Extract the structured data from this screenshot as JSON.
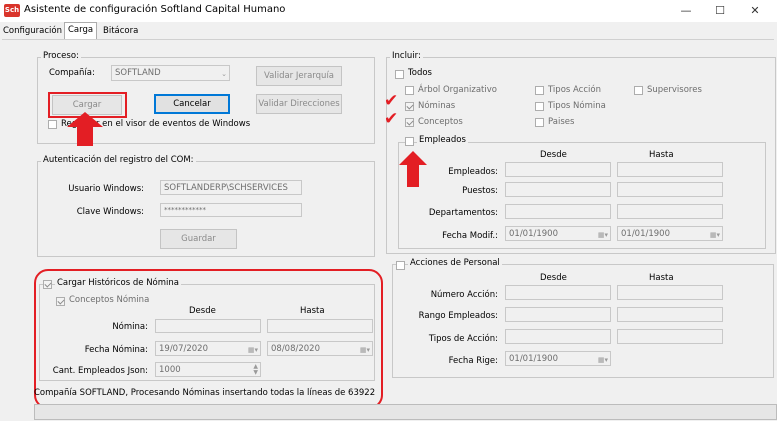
{
  "window": {
    "title": "Asistente de configuración Softland Capital Humano",
    "app_icon_text": "Sch"
  },
  "tabs": [
    {
      "label": "Configuración"
    },
    {
      "label": "Carga"
    },
    {
      "label": "Bitácora"
    }
  ],
  "proceso": {
    "group_label": "Proceso:",
    "company_label": "Compañía:",
    "company_value": "SOFTLAND",
    "validar_jerarquia": "Validar Jerarquía",
    "validar_direcciones": "Validar Direcciones",
    "cargar": "Cargar",
    "cancelar": "Cancelar",
    "registrar": "Registrar en el visor de eventos de Windows"
  },
  "auth": {
    "group_label": "Autenticación del registro del COM:",
    "usuario_label": "Usuario Windows:",
    "usuario_value": "SOFTLANDERP\\SCHSERVICES",
    "clave_label": "Clave Windows:",
    "clave_value": "************",
    "guardar": "Guardar"
  },
  "historicos": {
    "label": "Cargar Históricos de Nómina",
    "conceptos_label": "Conceptos Nómina",
    "desde": "Desde",
    "hasta": "Hasta",
    "nomina_label": "Nómina:",
    "fecha_nomina_label": "Fecha Nómina:",
    "fecha_desde": "19/07/2020",
    "fecha_hasta": "08/08/2020",
    "cant_label": "Cant. Empleados Json:",
    "cant_value": "1000"
  },
  "incluir": {
    "group_label": "Incluir:",
    "todos": "Todos",
    "arbol": "Árbol Organizativo",
    "tipos_accion": "Tipos Acción",
    "supervisores": "Supervisores",
    "nominas": "Nóminas",
    "tipos_nomina": "Tipos Nómina",
    "conceptos": "Conceptos",
    "paises": "Paises",
    "empleados_group": "Empleados",
    "desde": "Desde",
    "hasta": "Hasta",
    "empleados_label": "Empleados:",
    "puestos_label": "Puestos:",
    "departamentos_label": "Departamentos:",
    "fecha_modif_label": "Fecha Modif.:",
    "fecha_modif_desde": "01/01/1900",
    "fecha_modif_hasta": "01/01/1900"
  },
  "acciones": {
    "group_label": "Acciones de Personal",
    "desde": "Desde",
    "hasta": "Hasta",
    "numero_label": "Número Acción:",
    "rango_label": "Rango Empleados:",
    "tipos_label": "Tipos de Acción:",
    "fecha_rige_label": "Fecha Rige:",
    "fecha_rige_value": "01/01/1900"
  },
  "status": {
    "text": "Compañía SOFTLAND, Procesando Nóminas insertando todas la líneas de 63922"
  },
  "annotation_colors": {
    "accent": "#e31e24"
  }
}
